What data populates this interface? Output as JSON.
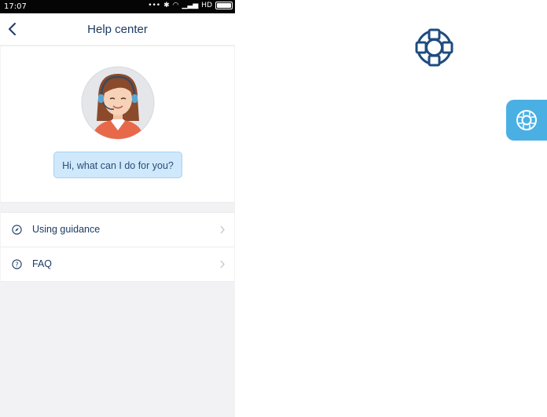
{
  "status_bar": {
    "time": "17:07",
    "signal_text": "HD"
  },
  "header": {
    "title": "Help center",
    "back_icon": "chevron-left-icon"
  },
  "hero": {
    "greeting": "Hi, what can I do for you?",
    "avatar_icon": "support-agent-avatar"
  },
  "menu": {
    "items": [
      {
        "label": "Using guidance",
        "icon": "compass-icon"
      },
      {
        "label": "FAQ",
        "icon": "question-circle-icon"
      }
    ]
  },
  "floating": {
    "icon": "lifebuoy-icon"
  },
  "colors": {
    "title": "#1c3b63",
    "bubble": "#cfe8fb",
    "fab": "#4ab0e4",
    "lifebuoy": "#1f4c80"
  }
}
